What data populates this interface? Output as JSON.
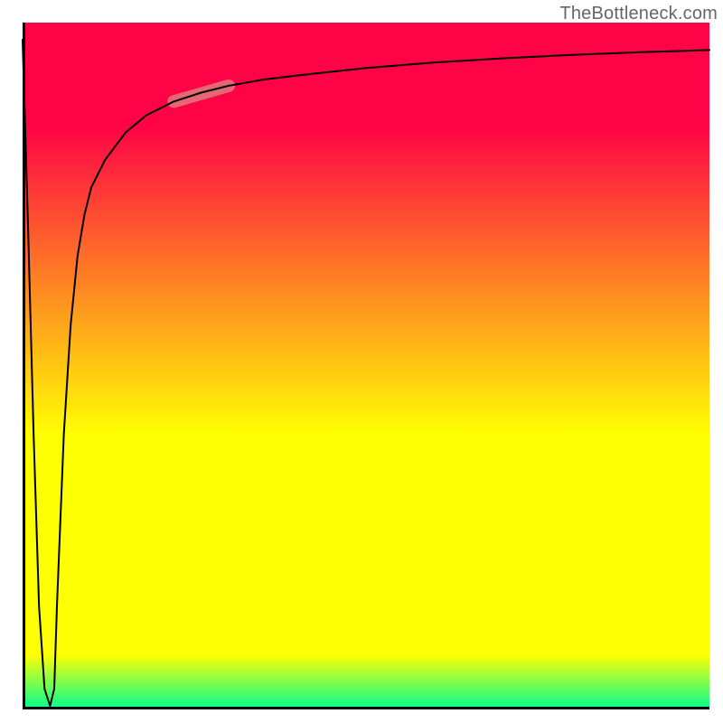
{
  "watermark": {
    "text": "TheBottleneck.com"
  },
  "colors": {
    "accent_highlight": "#d98b82",
    "curve": "#000000",
    "axis": "#000000",
    "gradient_stops": [
      "#fe0345",
      "#fe0345",
      "#ffff03",
      "#ffff03",
      "#01fe92"
    ]
  },
  "chart_data": {
    "type": "line",
    "title": "",
    "xlabel": "",
    "ylabel": "",
    "xlim": [
      0,
      100
    ],
    "ylim": [
      0,
      100
    ],
    "grid": false,
    "legend": false,
    "x": [
      0,
      0.8,
      1.6,
      2.4,
      3.2,
      4.0,
      4.6,
      5,
      6,
      7,
      8,
      9,
      10,
      12,
      15,
      18,
      22,
      26,
      30,
      35,
      40,
      50,
      60,
      70,
      80,
      90,
      100
    ],
    "series": [
      {
        "name": "curve",
        "y": [
          97.5,
          70,
          40,
          15,
          3,
          0.5,
          3,
          15,
          40,
          56,
          66,
          72,
          76,
          80,
          84,
          86.5,
          88.5,
          89.8,
          90.8,
          91.7,
          92.3,
          93.4,
          94.2,
          94.8,
          95.3,
          95.7,
          96.0
        ]
      }
    ],
    "highlight_segment": {
      "x_start": 22,
      "x_end": 30,
      "y_start": 88.5,
      "y_end": 90.8
    }
  }
}
